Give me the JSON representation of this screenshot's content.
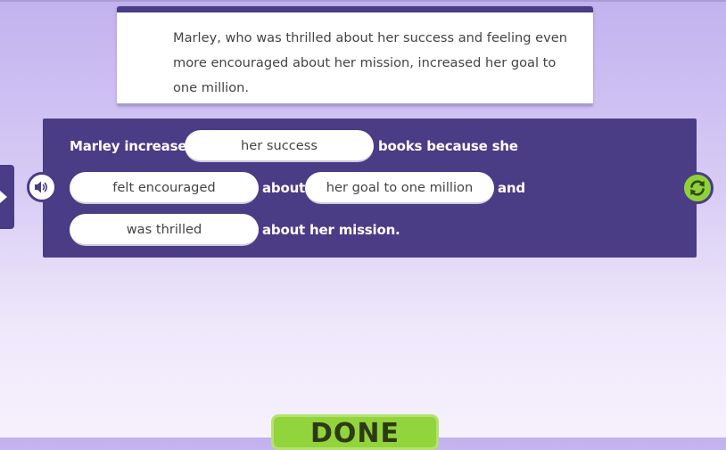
{
  "passage": {
    "text": "Marley, who was thrilled about her success and feeling even more encouraged about her mission, increased her goal to one million."
  },
  "sentence": {
    "line1": {
      "text1": "Marley increased",
      "slot1": "her success",
      "text2": "books because she"
    },
    "line2": {
      "slot2": "felt encouraged",
      "text3": "about",
      "slot3": "her goal to one million",
      "text4": "and"
    },
    "line3": {
      "slot4": "was thrilled",
      "text5": "about her mission."
    }
  },
  "buttons": {
    "done_label": "DONE",
    "audio_icon": "speaker-icon",
    "refresh_icon": "refresh-icon"
  },
  "colors": {
    "panel": "#4a3c85",
    "done": "#92d43c",
    "refresh": "#8fd13a"
  }
}
